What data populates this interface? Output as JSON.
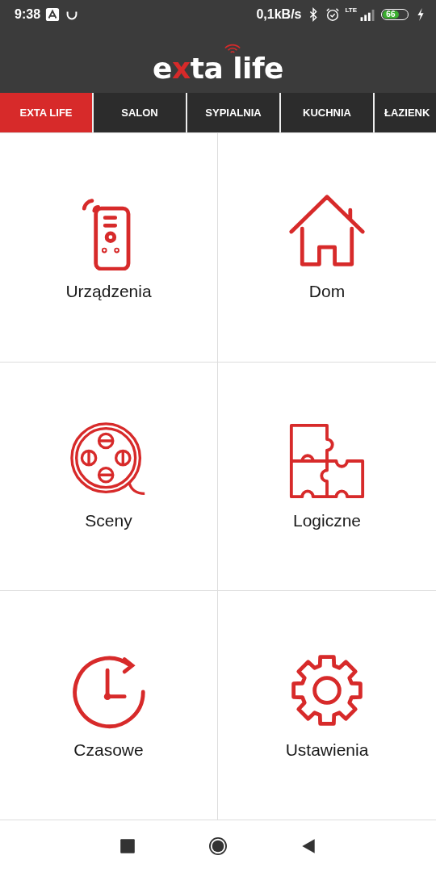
{
  "status_bar": {
    "time": "9:38",
    "net_speed": "0,1kB/s",
    "network": "LTE",
    "battery": "66",
    "charging": true
  },
  "logo": [
    {
      "text": "e",
      "accent": false
    },
    {
      "text": "x",
      "accent": true
    },
    {
      "text": "ta life",
      "accent": false
    }
  ],
  "tabs": [
    {
      "label": "EXTA LIFE",
      "selected": true
    },
    {
      "label": "SALON",
      "selected": false
    },
    {
      "label": "SYPIALNIA",
      "selected": false
    },
    {
      "label": "KUCHNIA",
      "selected": false
    },
    {
      "label": "ŁAZIENK",
      "selected": false
    }
  ],
  "tiles": [
    {
      "label": "Urządzenia",
      "kind": "remote"
    },
    {
      "label": "Dom",
      "kind": "house"
    },
    {
      "label": "Sceny",
      "kind": "reel"
    },
    {
      "label": "Logiczne",
      "kind": "puzzle"
    },
    {
      "label": "Czasowe",
      "kind": "clock"
    },
    {
      "label": "Ustawienia",
      "kind": "gear"
    }
  ]
}
